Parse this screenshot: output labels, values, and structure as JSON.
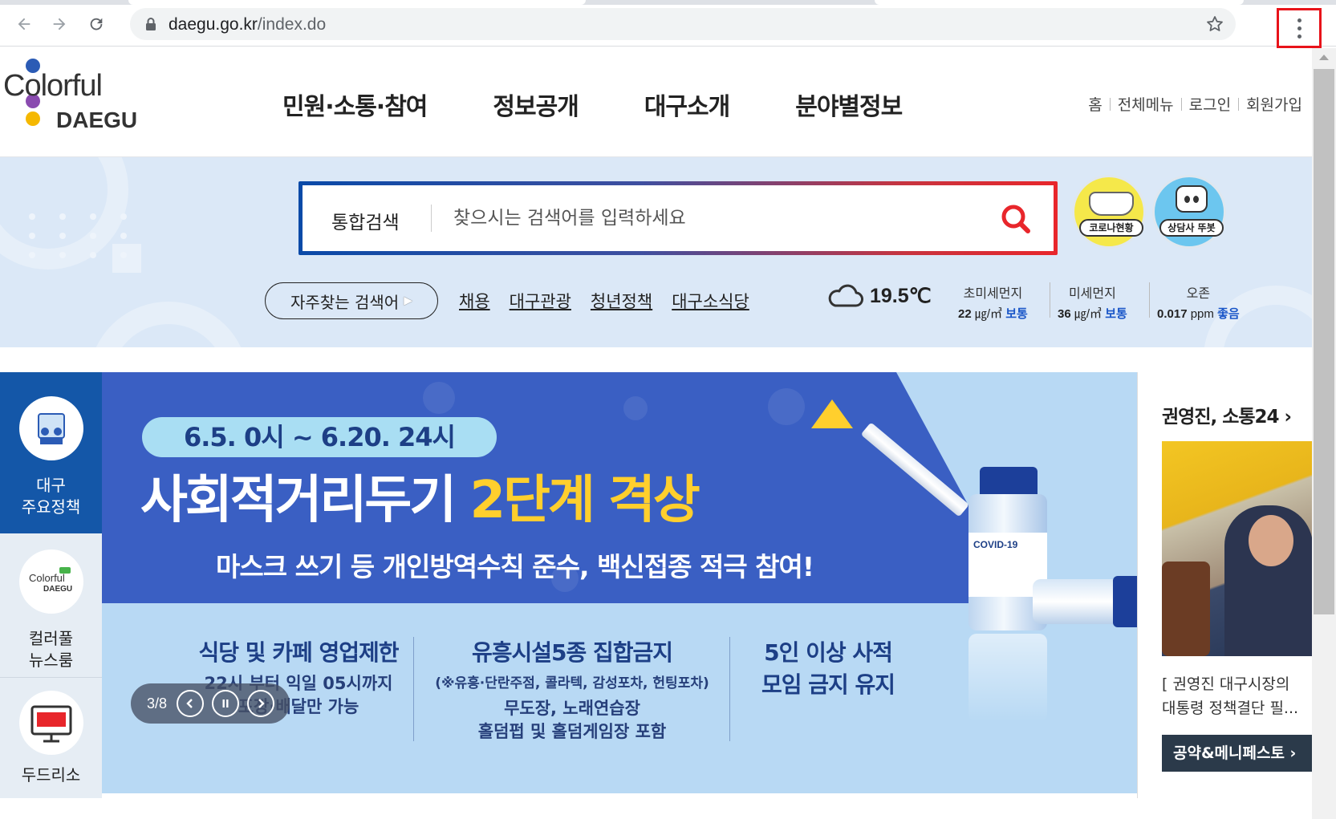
{
  "browser": {
    "url_host": "daegu.go.kr",
    "url_path": "/index.do",
    "icons": [
      "back-icon",
      "forward-icon",
      "reload-icon",
      "lock-icon",
      "star-icon",
      "more-vert-icon"
    ]
  },
  "header": {
    "logo_text_top": "Colorful",
    "logo_text_bottom": "DAEGU",
    "logo_colors": [
      "#2b5bb5",
      "#e8262b",
      "#8a4bb0",
      "#f5b800"
    ],
    "nav": [
      "민원·소통·참여",
      "정보공개",
      "대구소개",
      "분야별정보"
    ],
    "util": [
      "홈",
      "전체메뉴",
      "로그인",
      "회원가입"
    ]
  },
  "search": {
    "label": "통합검색",
    "placeholder": "찾으시는 검색어를 입력하세요",
    "badge_covid": "코로나현황",
    "badge_bot": "상담사 뚜봇",
    "freq_label": "자주찾는 검색어",
    "freq_links": [
      "채용",
      "대구관광",
      "청년정책",
      "대구소식당"
    ]
  },
  "weather": {
    "temp": "19.5℃",
    "air": [
      {
        "name": "초미세먼지",
        "value": "22",
        "unit": "㎍/㎥",
        "status": "보통"
      },
      {
        "name": "미세먼지",
        "value": "36",
        "unit": "㎍/㎥",
        "status": "보통"
      },
      {
        "name": "오존",
        "value": "0.017",
        "unit": "ppm",
        "status": "좋음"
      }
    ]
  },
  "side_menu": [
    {
      "label": "대구\n주요정책"
    },
    {
      "label": "컬러풀\n뉴스룸"
    },
    {
      "label": "두드리소"
    }
  ],
  "banner": {
    "date_range": "6.5. 0시 ~ 6.20. 24시",
    "headline_a": "사회적거리두기 ",
    "headline_b": "2단계 격상",
    "sub": "마스크 쓰기 등 개인방역수칙 준수, 백신접종 적극 참여!",
    "vial_label": "COVID-19",
    "col1_title": "식당 및 카페 영업제한",
    "col1_line1": "22시 부터 익일 05시까지",
    "col1_line2": "포장·배달만 가능",
    "col2_title": "유흥시설5종 집합금지",
    "col2_line1": "(※유흥·단란주점, 콜라텍, 감성포차, 헌팅포차)",
    "col2_line2": "무도장, 노래연습장",
    "col2_line3": "홀덤펍 및 홀덤게임장 포함",
    "col3_title": "5인 이상 사적",
    "col3_title2": "모임 금지 유지",
    "counter": "3/8"
  },
  "side_card": {
    "title": "권영진, 소통24 ›",
    "caption": "[ 권영진 대구시장의\n대통령 정책결단 필...",
    "button": "공약&메니페스토 ›"
  }
}
